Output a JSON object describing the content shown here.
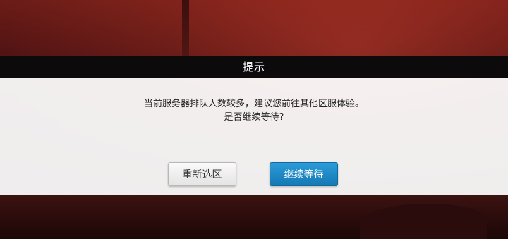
{
  "dialog": {
    "title": "提示",
    "message_line1": "当前服务器排队人数较多，建议您前往其他区服体验。",
    "message_line2": "是否继续等待?",
    "buttons": {
      "reselect_label": "重新选区",
      "continue_label": "继续等待"
    }
  },
  "colors": {
    "header_bg": "#0c0a0a",
    "body_bg": "#ffffff",
    "primary_button": "#1f8bc8",
    "secondary_button": "#ececec",
    "background_tone": "#6e1f1a"
  }
}
